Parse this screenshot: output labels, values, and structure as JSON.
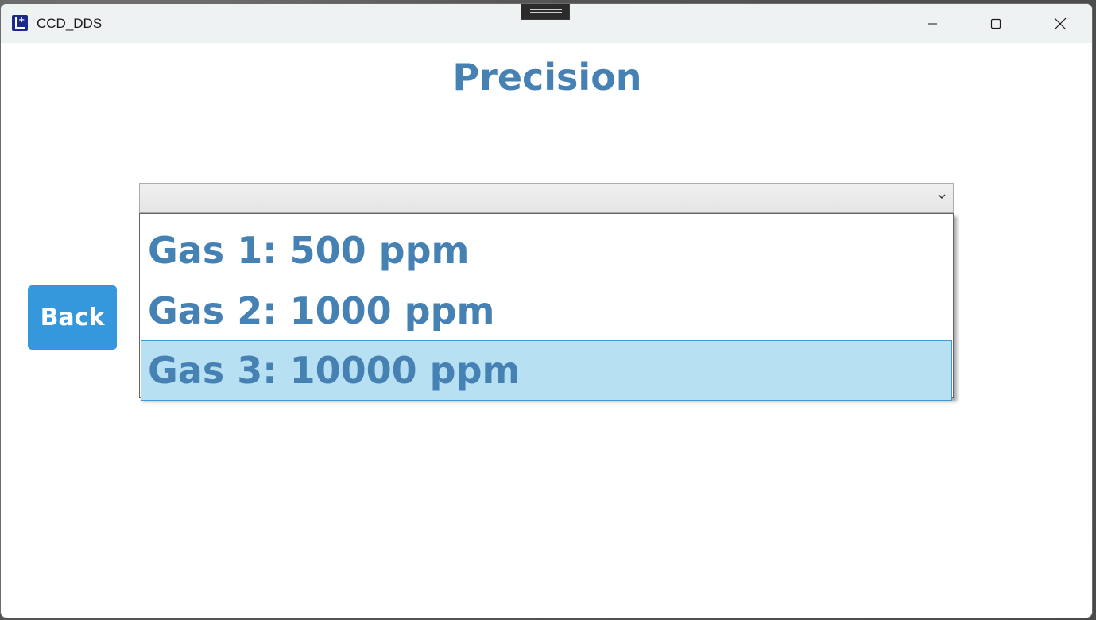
{
  "window": {
    "title": "CCD_DDS",
    "app_icon": "app-logo-icon",
    "controls": [
      "minimize-icon",
      "maximize-icon",
      "close-icon"
    ]
  },
  "page": {
    "title": "Precision"
  },
  "back_button": {
    "label": "Back"
  },
  "combo": {
    "selected_value": "",
    "icon": "chevron-down-icon",
    "options": [
      {
        "label": "Gas 1: 500 ppm",
        "highlighted": false
      },
      {
        "label": "Gas 2: 1000 ppm",
        "highlighted": false
      },
      {
        "label": "Gas 3: 10000 ppm",
        "highlighted": true
      }
    ]
  },
  "colors": {
    "accent": "#4681b4",
    "button": "#3598dc",
    "highlight": "#b7e0f3",
    "highlight_border": "#3d9ad6"
  }
}
